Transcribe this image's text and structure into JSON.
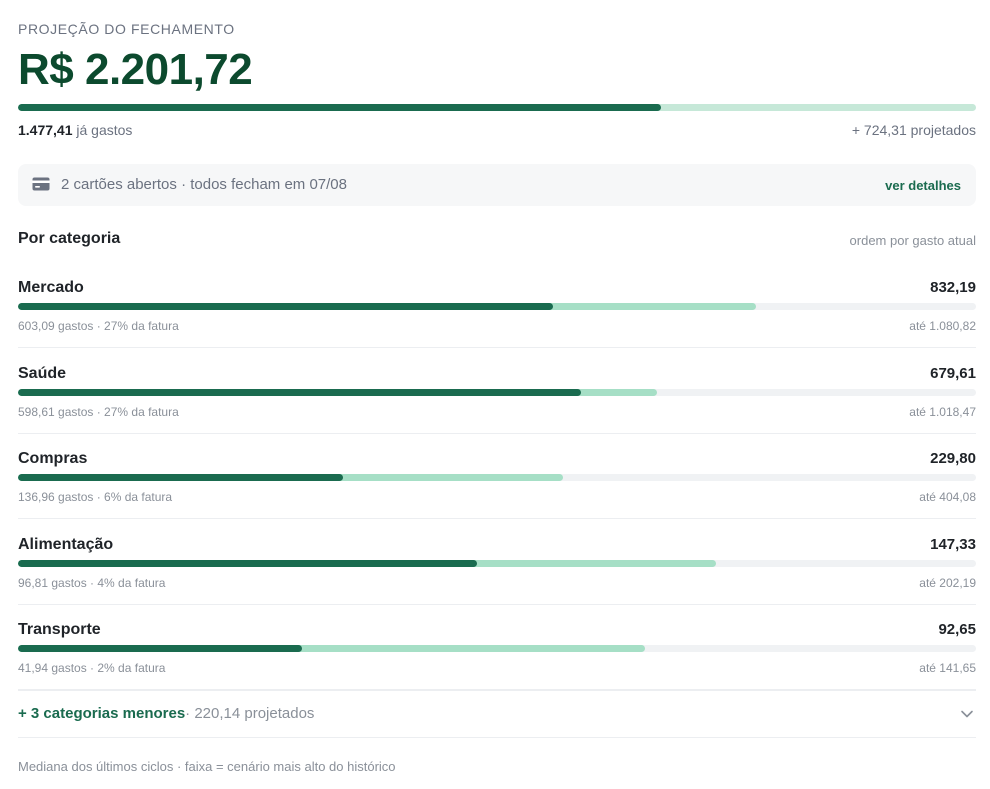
{
  "header": {
    "eyebrow": "PROJEÇÃO DO FECHAMENTO",
    "total": "R$ 2.201,72",
    "spent_value": "1.477,41",
    "spent_suffix": " já gastos",
    "projected": "+ 724,31 projetados",
    "progress": {
      "spent_fraction": 0.671
    }
  },
  "cards": {
    "icon": "credit-card-icon",
    "text": "2 cartões abertos · todos fecham em 07/08",
    "link": "ver detalhes"
  },
  "section": {
    "title": "Por categoria",
    "sort": "ordem por gasto atual"
  },
  "categories": [
    {
      "name": "Mercado",
      "value": "832,19",
      "sub": "603,09 gastos · 27% da fatura",
      "upto": "até 1.080,82",
      "spent_pct": 55.8,
      "proj_pct": 77.0
    },
    {
      "name": "Saúde",
      "value": "679,61",
      "sub": "598,61 gastos · 27% da fatura",
      "upto": "até 1.018,47",
      "spent_pct": 58.8,
      "proj_pct": 66.7
    },
    {
      "name": "Compras",
      "value": "229,80",
      "sub": "136,96 gastos · 6% da fatura",
      "upto": "até 404,08",
      "spent_pct": 33.9,
      "proj_pct": 56.9
    },
    {
      "name": "Alimentação",
      "value": "147,33",
      "sub": "96,81 gastos · 4% da fatura",
      "upto": "até 202,19",
      "spent_pct": 47.9,
      "proj_pct": 72.9
    },
    {
      "name": "Transporte",
      "value": "92,65",
      "sub": "41,94 gastos · 2% da fatura",
      "upto": "até 141,65",
      "spent_pct": 29.6,
      "proj_pct": 65.4
    }
  ],
  "minor": {
    "link": "+ 3 categorias menores",
    "rest": "· 220,14 projetados",
    "icon": "chevron-down-icon"
  },
  "footnote": "Mediana dos últimos ciclos · faixa = cenário mais alto do histórico",
  "colors": {
    "spent": "#1a6b4f",
    "projected": "#a6dfc6",
    "track": "#f0f2f4",
    "accent_text": "#0c4a2e"
  }
}
